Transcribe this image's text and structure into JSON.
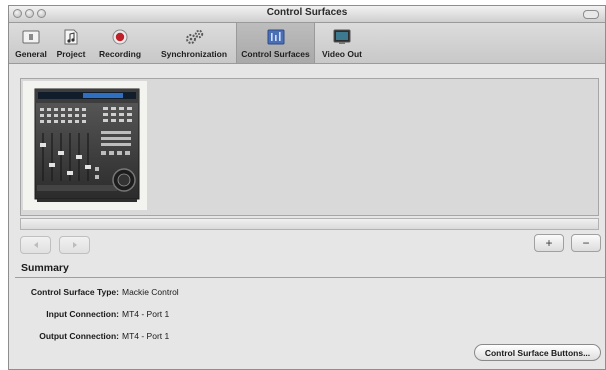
{
  "window": {
    "title": "Control Surfaces"
  },
  "toolbar": {
    "items": [
      {
        "label": "General",
        "icon": "general-icon"
      },
      {
        "label": "Project",
        "icon": "project-icon"
      },
      {
        "label": "Recording",
        "icon": "record-icon"
      },
      {
        "label": "Synchronization",
        "icon": "gears-icon"
      },
      {
        "label": "Control Surfaces",
        "icon": "control-surfaces-icon",
        "selected": true
      },
      {
        "label": "Video Out",
        "icon": "monitor-icon"
      }
    ]
  },
  "device": {
    "name_icon": "mackie-control-device-icon"
  },
  "buttons": {
    "prev_icon": "left-arrow-icon",
    "next_icon": "right-arrow-icon",
    "add_label": "+",
    "remove_label": "−",
    "control_surface_buttons": "Control Surface Buttons..."
  },
  "summary": {
    "title": "Summary",
    "rows": [
      {
        "key": "Control Surface Type:",
        "value": "Mackie Control"
      },
      {
        "key": "Input Connection:",
        "value": "MT4 - Port 1"
      },
      {
        "key": "Output Connection:",
        "value": "MT4 - Port 1"
      }
    ]
  },
  "colors": {
    "selected_tab": "#b0b0b0",
    "window_bg": "#e6e6e6"
  }
}
